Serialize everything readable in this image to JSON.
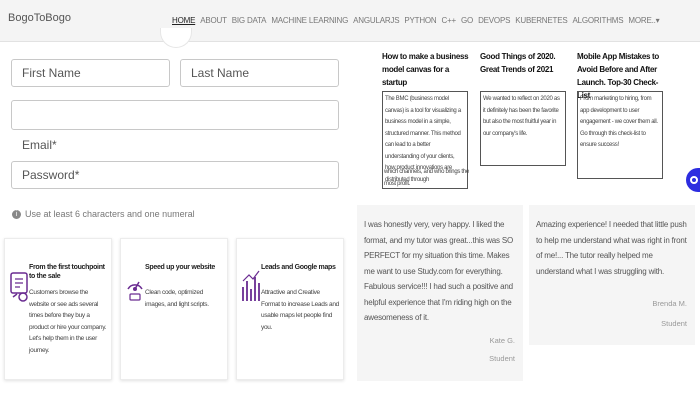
{
  "header": {
    "brand": "BogoToBogo",
    "nav": [
      "HOME",
      "ABOUT",
      "BIG DATA",
      "MACHINE LEARNING",
      "ANGULARJS",
      "PYTHON",
      "C++",
      "GO",
      "DEVOPS",
      "KUBERNETES",
      "ALGORITHMS",
      "MORE..▾"
    ],
    "active": "HOME"
  },
  "form": {
    "first_name_placeholder": "First Name",
    "last_name_placeholder": "Last Name",
    "blank_value": "",
    "email_label": "Email*",
    "password_placeholder": "Password*",
    "hint": "Use at least 6 characters and one numeral",
    "hint_icon": "info-icon"
  },
  "features": [
    {
      "icon": "touchpoint-icon",
      "title": "From the first touchpoint to the sale",
      "body": "Customers browse the website or see ads several times before they buy a product or hire your company. Let's help them in the user journey."
    },
    {
      "icon": "speed-icon",
      "title": "Speed up your website",
      "body": "Clean code, optimized images, and light scripts."
    },
    {
      "icon": "leads-chart-icon",
      "title": "Leads and Google maps",
      "body": "Attractive and Creative Format to increase Leads and usable maps let people find you."
    }
  ],
  "articles": [
    {
      "title": "How to make a business model canvas for a startup",
      "excerpt": "The BMC (business model canvas) is a tool for visualizing a business model in a simple, structured manner. This method can lead to a better understanding of your clients, how product innovations are distributed through",
      "excerpt_tail": "which channels, and who brings the most profit."
    },
    {
      "title": "Good Things of 2020. Great Trends of 2021",
      "excerpt": "We wanted to reflect on 2020 as it definitely has been the favorite but also the most fruitful year in our company's life."
    },
    {
      "title": "Mobile App Mistakes to Avoid Before and After Launch. Top-30 Check-List",
      "excerpt": "From marketing to hiring, from app development to user engagement - we cover them all. Go through this check-list to ensure success!"
    }
  ],
  "testimonials": [
    {
      "text": "I was honestly very, very happy. I liked the format, and my tutor was great...this was SO PERFECT for my situation this time. Makes me want to use Study.com for everything. Fabulous service!!! I had such a positive and helpful experience that I'm riding high on the awesomeness of it.",
      "name": "Kate G.",
      "role": "Student"
    },
    {
      "text": "Amazing experience! I needed that little push to help me understand what was right in front of me!... The tutor really helped me understand what I was struggling with.",
      "name": "Brenda M.",
      "role": "Student"
    }
  ],
  "chat_icon": "chat-icon",
  "colors": {
    "accent": "#6a2c91",
    "chat": "#2d2de0"
  }
}
